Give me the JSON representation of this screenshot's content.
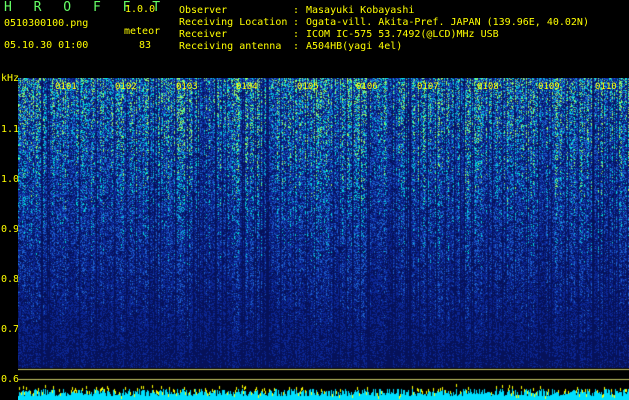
{
  "app": {
    "title": "H R O F F T",
    "version": "1.0.0",
    "filename": "0510300100.png",
    "datetime": "05.10.30 01:00",
    "meteor_label": "meteor",
    "meteor_count": "83"
  },
  "station": [
    {
      "label": "Observer",
      "value": "Masayuki Kobayashi"
    },
    {
      "label": "Receiving Location",
      "value": "Ogata-vill. Akita-Pref. JAPAN (139.96E, 40.02N)"
    },
    {
      "label": "Receiver",
      "value": "ICOM IC-575 53.7492(@LCD)MHz USB"
    },
    {
      "label": "Receiving antenna",
      "value": "A504HB(yagi 4el)"
    }
  ],
  "colon": ":",
  "axis": {
    "y_unit": "kHz",
    "y_ticks": [
      "1.1",
      "1.0",
      "0.9",
      "0.8",
      "0.7",
      "0.6"
    ],
    "x_ticks": [
      "0101",
      "0102",
      "0103",
      "0104",
      "0105",
      "0106",
      "0107",
      "0108",
      "0109",
      "0110"
    ]
  },
  "colors": {
    "text": "#ffff00",
    "title": "#66ff66",
    "background": "#000000",
    "noise_dark": "#0a1a6e",
    "noise_mid": "#1e64d2",
    "noise_high": "#00dcdc",
    "noise_peak": "#96ff64",
    "baseline": "#00e0ff"
  }
}
